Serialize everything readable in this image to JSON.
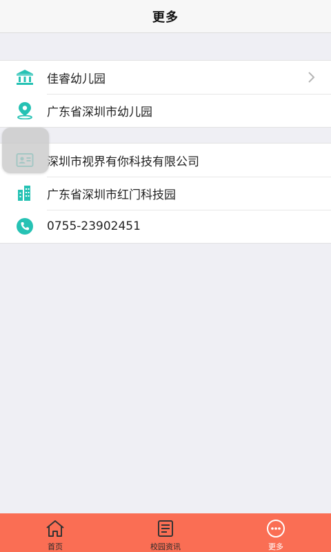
{
  "header": {
    "title": "更多"
  },
  "school": {
    "name": "佳睿幼儿园",
    "address": "广东省深圳市幼儿园"
  },
  "company": {
    "name": "深圳市视界有你科技有限公司",
    "address": "广东省深圳市红门科技园",
    "phone": "0755-23902451"
  },
  "tabs": [
    {
      "label": "首页",
      "icon": "home-icon"
    },
    {
      "label": "校园资讯",
      "icon": "news-icon"
    },
    {
      "label": "更多",
      "icon": "more-icon"
    }
  ],
  "colors": {
    "accent": "#26c2b4",
    "tabbar": "#fa6e54",
    "background": "#efeff4"
  }
}
